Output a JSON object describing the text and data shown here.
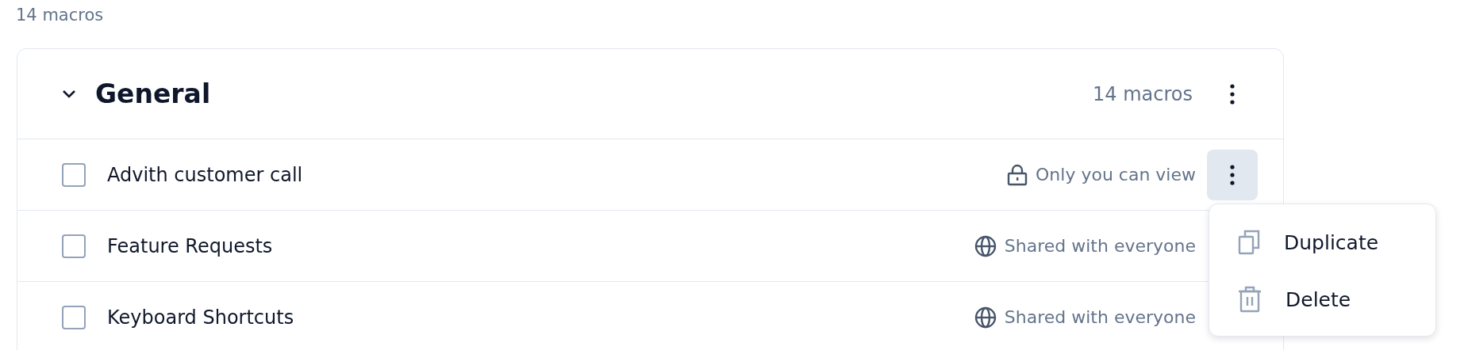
{
  "summary": "14 macros",
  "group": {
    "title": "General",
    "expanded": true,
    "count": "14 macros",
    "rows": [
      {
        "label": "Advith customer call",
        "checked": false,
        "visibility": {
          "kind": "private",
          "label": "Only you can view"
        },
        "menu_open": true
      },
      {
        "label": "Feature Requests",
        "checked": false,
        "visibility": {
          "kind": "public",
          "label": "Shared with everyone"
        },
        "menu_open": false
      },
      {
        "label": "Keyboard Shortcuts",
        "checked": false,
        "visibility": {
          "kind": "public",
          "label": "Shared with everyone"
        },
        "menu_open": false
      }
    ]
  },
  "menu": {
    "items": [
      {
        "kind": "duplicate",
        "label": "Duplicate"
      },
      {
        "kind": "delete",
        "label": "Delete"
      }
    ]
  }
}
